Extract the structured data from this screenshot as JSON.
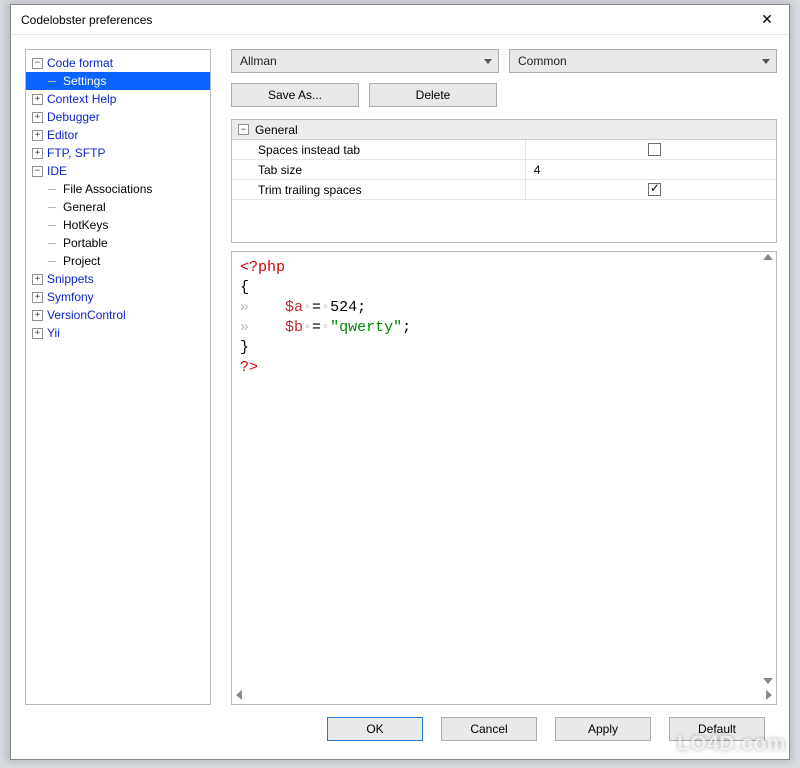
{
  "window": {
    "title": "Codelobster preferences"
  },
  "tree": [
    {
      "label": "Code format",
      "kind": "cat",
      "exp": "minus",
      "children": [
        {
          "label": "Settings",
          "kind": "leaf",
          "selected": true
        }
      ]
    },
    {
      "label": "Context Help",
      "kind": "cat",
      "exp": "plus"
    },
    {
      "label": "Debugger",
      "kind": "cat",
      "exp": "plus"
    },
    {
      "label": "Editor",
      "kind": "cat",
      "exp": "plus"
    },
    {
      "label": "FTP, SFTP",
      "kind": "cat",
      "exp": "plus"
    },
    {
      "label": "IDE",
      "kind": "cat",
      "exp": "minus",
      "children": [
        {
          "label": "File Associations",
          "kind": "leaf"
        },
        {
          "label": "General",
          "kind": "leaf"
        },
        {
          "label": "HotKeys",
          "kind": "leaf"
        },
        {
          "label": "Portable",
          "kind": "leaf"
        },
        {
          "label": "Project",
          "kind": "leaf"
        }
      ]
    },
    {
      "label": "Snippets",
      "kind": "cat",
      "exp": "plus"
    },
    {
      "label": "Symfony",
      "kind": "cat",
      "exp": "plus"
    },
    {
      "label": "VersionControl",
      "kind": "cat",
      "exp": "plus"
    },
    {
      "label": "Yii",
      "kind": "cat",
      "exp": "plus"
    }
  ],
  "combos": {
    "style": "Allman",
    "scope": "Common"
  },
  "buttons": {
    "saveas": "Save As...",
    "delete": "Delete"
  },
  "grid": {
    "section": "General",
    "rows": [
      {
        "key": "Spaces instead tab",
        "val_type": "check",
        "checked": false
      },
      {
        "key": "Tab size",
        "val_type": "text",
        "value": "4"
      },
      {
        "key": "Trim trailing spaces",
        "val_type": "check",
        "checked": true
      }
    ]
  },
  "code": {
    "l1": "<?php",
    "l2": "{",
    "l3_indent": "»    ",
    "l3_var": "$a",
    "l3_ws1": "◦",
    "l3_eq": "=",
    "l3_ws2": "◦",
    "l3_num": "524;",
    "l4_indent": "»    ",
    "l4_var": "$b",
    "l4_ws1": "◦",
    "l4_eq": "=",
    "l4_ws2": "◦",
    "l4_str": "\"qwerty\"",
    "l4_semi": ";",
    "l5": "}",
    "l6": "?>"
  },
  "footer": {
    "ok": "OK",
    "cancel": "Cancel",
    "apply": "Apply",
    "default": "Default"
  },
  "watermark": "LO4D.com"
}
